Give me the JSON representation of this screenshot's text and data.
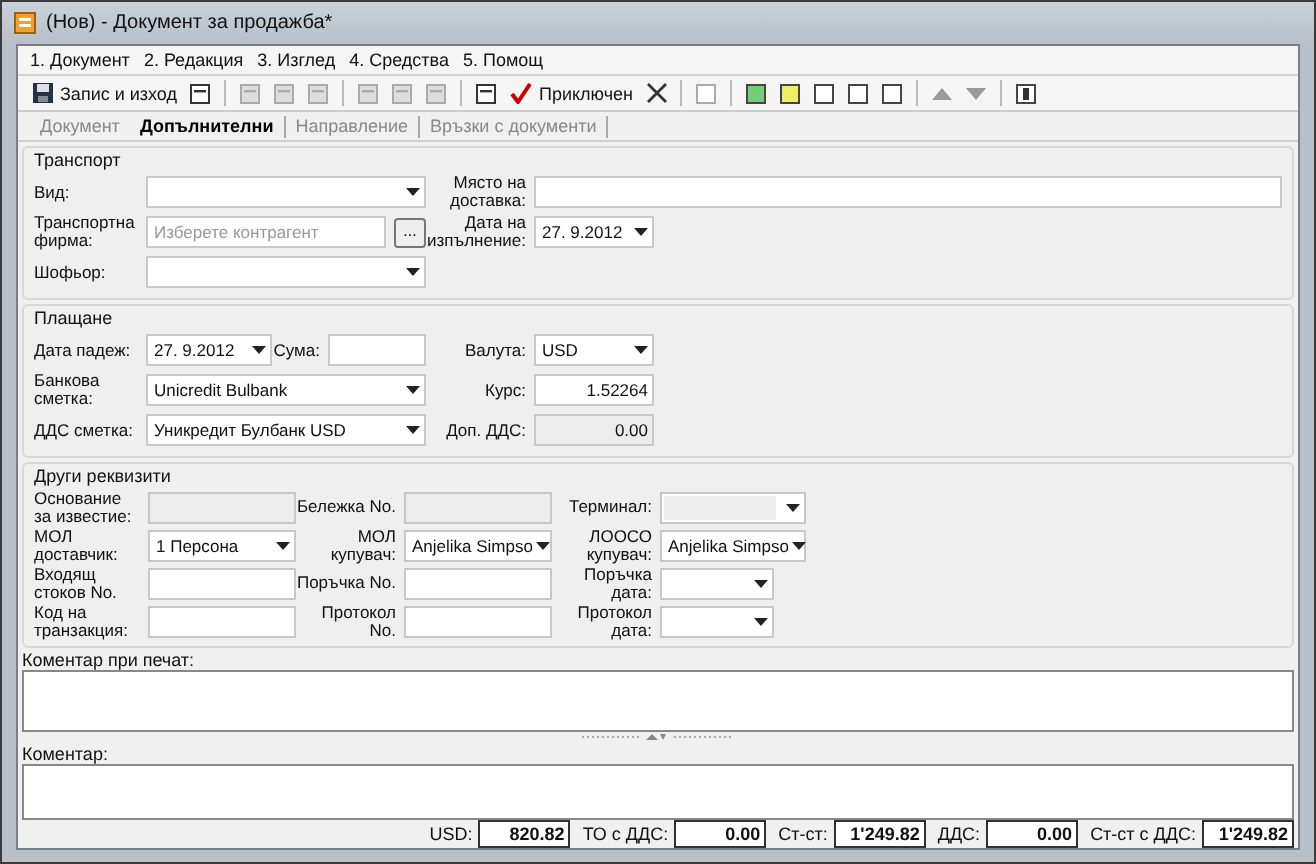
{
  "window": {
    "title": "(Нов) - Документ за продажба*"
  },
  "menu": [
    {
      "label": "1. Документ"
    },
    {
      "label": "2. Редакция"
    },
    {
      "label": "3. Изглед"
    },
    {
      "label": "4. Средства"
    },
    {
      "label": "5. Помощ"
    }
  ],
  "toolbar": {
    "save_label": "Запис и изход",
    "close_label": "Приключен"
  },
  "tabs": [
    {
      "label": "Документ",
      "selected": false
    },
    {
      "label": "Допълнителни",
      "selected": true
    },
    {
      "label": "Направление",
      "selected": false
    },
    {
      "label": "Връзки с документи",
      "selected": false
    }
  ],
  "sections": [
    {
      "title": "Транспорт",
      "fields": [
        {
          "label": "Вид:",
          "kind": "combo"
        },
        {
          "label": "Място на доставка:",
          "kind": "text"
        },
        {
          "label": "Транспортна фирма:",
          "kind": "picker",
          "placeholder": "Изберете контрагент",
          "button": "..."
        },
        {
          "label": "Дата на изпълнение:",
          "kind": "combo",
          "value": "27. 9.2012"
        },
        {
          "label": "Шофьор:",
          "kind": "combo"
        }
      ]
    },
    {
      "title": "Плащане",
      "fields": [
        {
          "label": "Дата падеж:",
          "kind": "combo",
          "value": "27. 9.2012"
        },
        {
          "label": "Сума:",
          "kind": "text"
        },
        {
          "label": "Валута:",
          "kind": "combo",
          "value": "USD"
        },
        {
          "label": "Банкова сметка:",
          "kind": "combo",
          "value": "Unicredit Bulbank"
        },
        {
          "label": "Курс:",
          "kind": "number",
          "value": "1.52264"
        },
        {
          "label": "ДДС сметка:",
          "kind": "combo",
          "value": "Уникредит Булбанк USD"
        },
        {
          "label": "Доп. ДДС:",
          "kind": "readonly_number",
          "value": "0.00"
        }
      ]
    },
    {
      "title": "Други реквизити",
      "fields": [
        {
          "label": "Основание за известие:",
          "kind": "readonly"
        },
        {
          "label": "Бележка No.",
          "kind": "readonly"
        },
        {
          "label": "Терминал:",
          "kind": "readonly_combo"
        },
        {
          "label": "МОЛ доставчик:",
          "kind": "combo",
          "value": "1 Персона"
        },
        {
          "label": "МОЛ купувач:",
          "kind": "combo",
          "value": "Anjelika Simpso"
        },
        {
          "label": "ЛООСО купувач:",
          "kind": "combo",
          "value": "Anjelika Simpso"
        },
        {
          "label": "Входящ стоков No.",
          "kind": "text"
        },
        {
          "label": "Поръчка No.",
          "kind": "text"
        },
        {
          "label": "Поръчка дата:",
          "kind": "combo"
        },
        {
          "label": "Код на транзакция:",
          "kind": "text"
        },
        {
          "label": "Протокол No.",
          "kind": "text"
        },
        {
          "label": "Протокол дата:",
          "kind": "combo"
        }
      ]
    }
  ],
  "print_comment": {
    "label": "Коментар при печат:"
  },
  "comment": {
    "label": "Коментар:"
  },
  "totals": [
    {
      "label": "USD:",
      "value": "820.82"
    },
    {
      "label": "ТО с ДДС:",
      "value": "0.00"
    },
    {
      "label": "Ст-ст:",
      "value": "1'249.82"
    },
    {
      "label": "ДДС:",
      "value": "0.00"
    },
    {
      "label": "Ст-ст с ДДС:",
      "value": "1'249.82"
    }
  ]
}
